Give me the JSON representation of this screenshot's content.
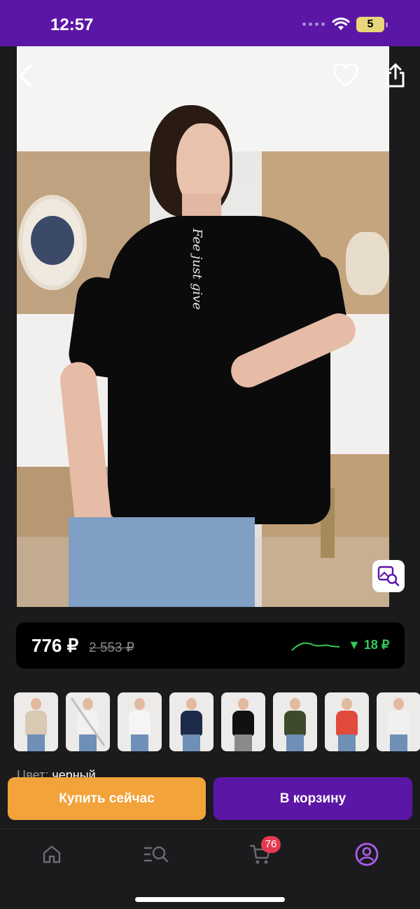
{
  "status": {
    "time": "12:57",
    "battery": "5"
  },
  "product": {
    "price": "776 ₽",
    "old_price": "2 553 ₽",
    "price_drop": "▼ 18 ₽",
    "color_label": "Цвет:",
    "color_value": "черный"
  },
  "colors": {
    "accent": "#5c16a6",
    "buy": "#f2a33a",
    "drop": "#35c75a",
    "badge": "#e53950"
  },
  "thumbnails": [
    {
      "name": "beige",
      "color": "#d8c9b2"
    },
    {
      "name": "white-crossed",
      "color": "#f2f1ef"
    },
    {
      "name": "white-black-pants",
      "color": "#f5f5f5"
    },
    {
      "name": "navy",
      "color": "#1e2a4a"
    },
    {
      "name": "black-skirt",
      "color": "#111111"
    },
    {
      "name": "olive",
      "color": "#3d4a2c"
    },
    {
      "name": "red",
      "color": "#e24a3c"
    },
    {
      "name": "white-print",
      "color": "#f0f0f0"
    }
  ],
  "actions": {
    "buy_now": "Купить сейчас",
    "add_to_cart": "В корзину"
  },
  "tabbar": {
    "items": [
      {
        "name": "home",
        "icon": "home-icon"
      },
      {
        "name": "catalog",
        "icon": "catalog-search-icon"
      },
      {
        "name": "cart",
        "icon": "cart-icon"
      },
      {
        "name": "profile",
        "icon": "profile-icon"
      }
    ],
    "cart_count": "76"
  }
}
